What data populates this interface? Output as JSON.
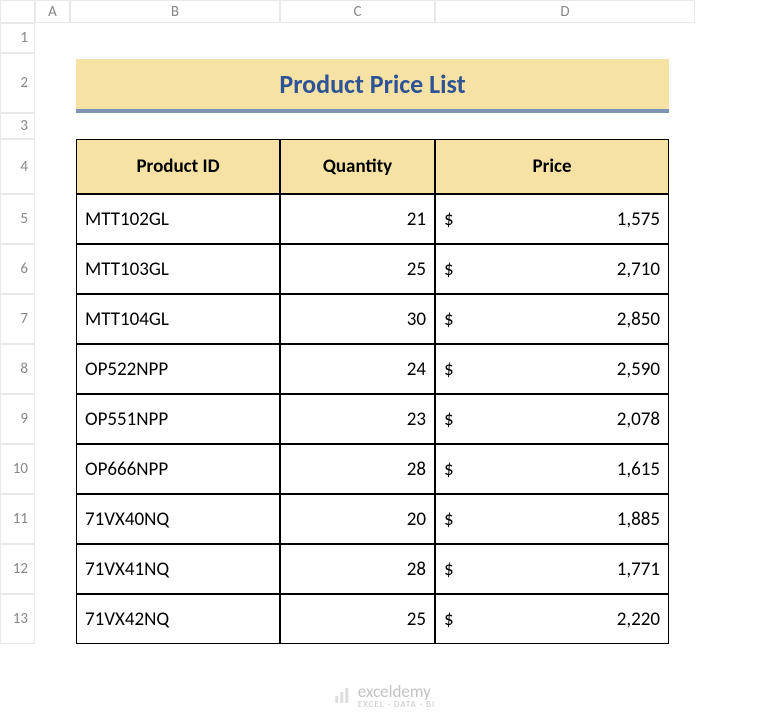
{
  "columns": [
    "A",
    "B",
    "C",
    "D"
  ],
  "rows": [
    "1",
    "2",
    "3",
    "4",
    "5",
    "6",
    "7",
    "8",
    "9",
    "10",
    "11",
    "12",
    "13"
  ],
  "title": "Product Price List",
  "headers": {
    "pid": "Product ID",
    "qty": "Quantity",
    "price": "Price"
  },
  "currency": "$",
  "products": [
    {
      "id": "MTT102GL",
      "qty": "21",
      "price": "1,575"
    },
    {
      "id": "MTT103GL",
      "qty": "25",
      "price": "2,710"
    },
    {
      "id": "MTT104GL",
      "qty": "30",
      "price": "2,850"
    },
    {
      "id": "OP522NPP",
      "qty": "24",
      "price": "2,590"
    },
    {
      "id": "OP551NPP",
      "qty": "23",
      "price": "2,078"
    },
    {
      "id": "OP666NPP",
      "qty": "28",
      "price": "1,615"
    },
    {
      "id": "71VX40NQ",
      "qty": "20",
      "price": "1,885"
    },
    {
      "id": "71VX41NQ",
      "qty": "28",
      "price": "1,771"
    },
    {
      "id": "71VX42NQ",
      "qty": "25",
      "price": "2,220"
    }
  ],
  "watermark": {
    "brand": "exceldemy",
    "tag": "EXCEL · DATA · BI"
  }
}
